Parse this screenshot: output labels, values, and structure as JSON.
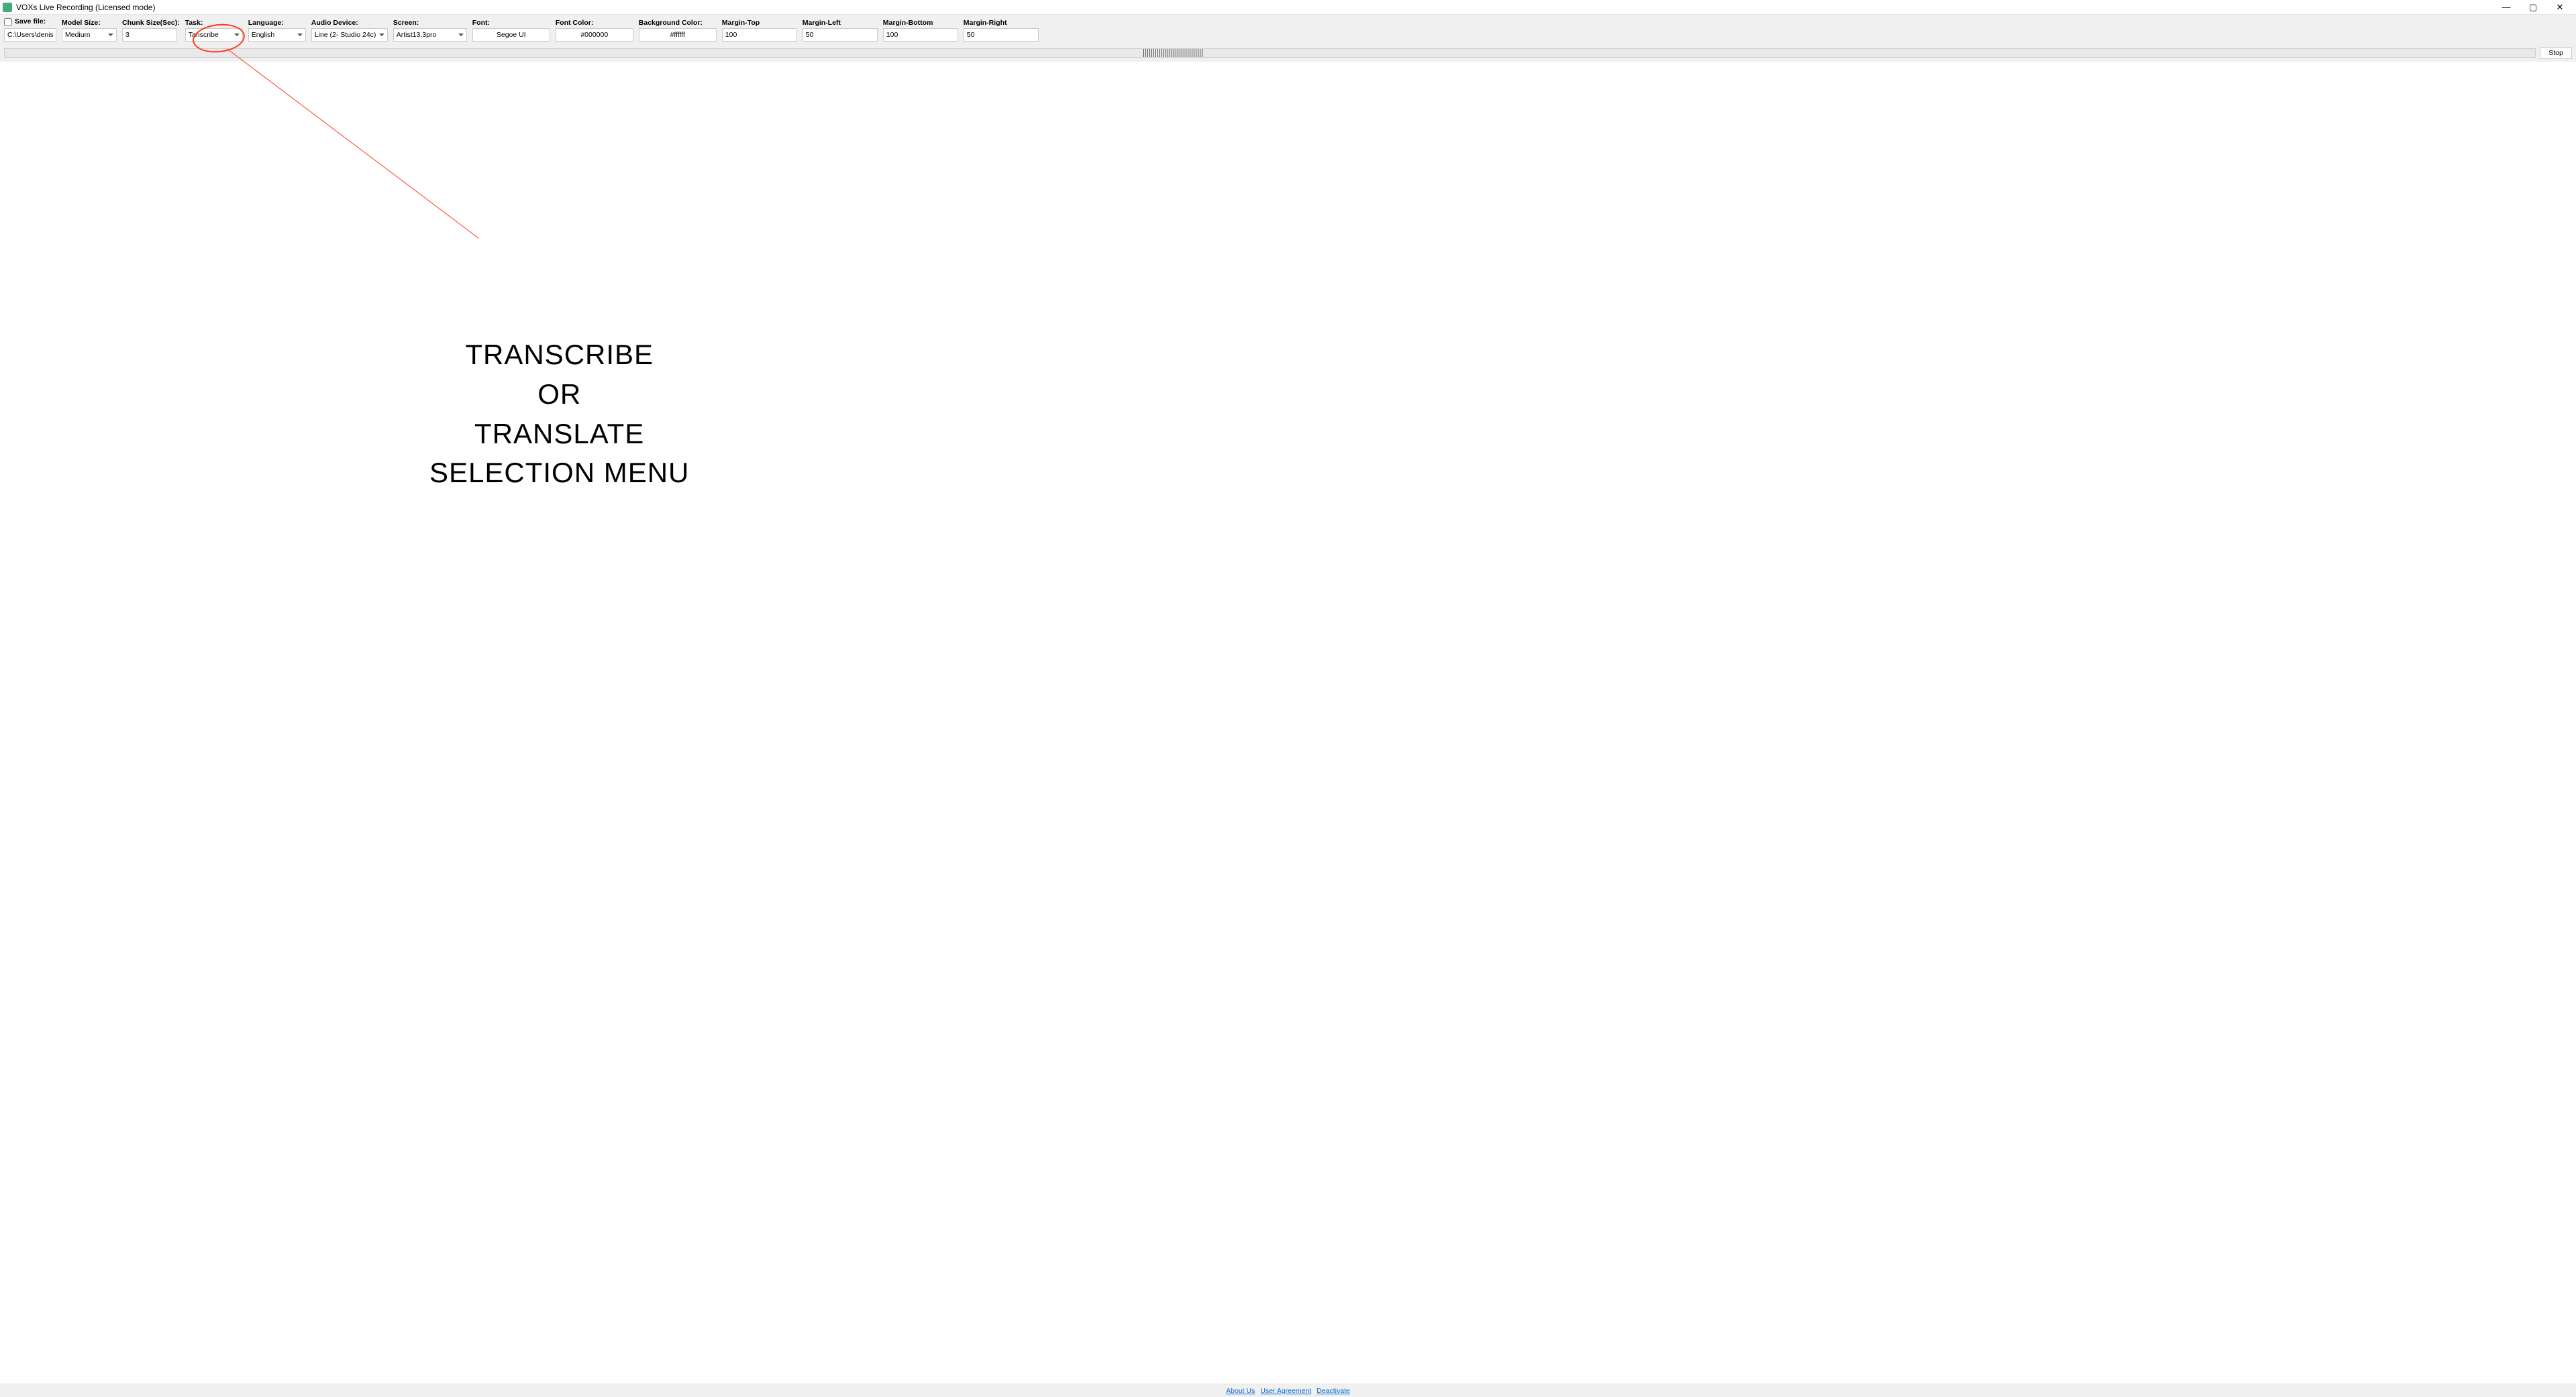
{
  "window": {
    "title": "VOXs Live Recording (Licensed mode)",
    "min": "—",
    "max": "▢",
    "close": "✕"
  },
  "toolbar": {
    "savefile": {
      "label": "Save file:",
      "value": "C:\\Users\\denis\\Desktop"
    },
    "model": {
      "label": "Model Size:",
      "value": "Medium"
    },
    "chunk": {
      "label": "Chunk Size(Sec):",
      "value": "3"
    },
    "task": {
      "label": "Task:",
      "value": "Tanscribe"
    },
    "lang": {
      "label": "Language:",
      "value": "English"
    },
    "audio": {
      "label": "Audio Device:",
      "value": "Line (2- Studio 24c)"
    },
    "screen": {
      "label": "Screen:",
      "value": "Artist13.3pro"
    },
    "font": {
      "label": "Font:",
      "value": "Segoe UI"
    },
    "fontcolor": {
      "label": "Font Color:",
      "value": "#000000"
    },
    "bgcolor": {
      "label": "Background Color:",
      "value": "#ffffff"
    },
    "mtop": {
      "label": "Margin-Top",
      "value": "100"
    },
    "mleft": {
      "label": "Margin-Left",
      "value": "50"
    },
    "mbottom": {
      "label": "Margin-Bottom",
      "value": "100"
    },
    "mright": {
      "label": "Margin-Right",
      "value": "50"
    },
    "stop": "Stop"
  },
  "callout": {
    "line1": "Transcribe",
    "line2": "or",
    "line3": "Translate",
    "line4": "selection menu"
  },
  "footer": {
    "about": "About Us",
    "agreement": "User Agreement",
    "deactivate": "Deactivate"
  }
}
